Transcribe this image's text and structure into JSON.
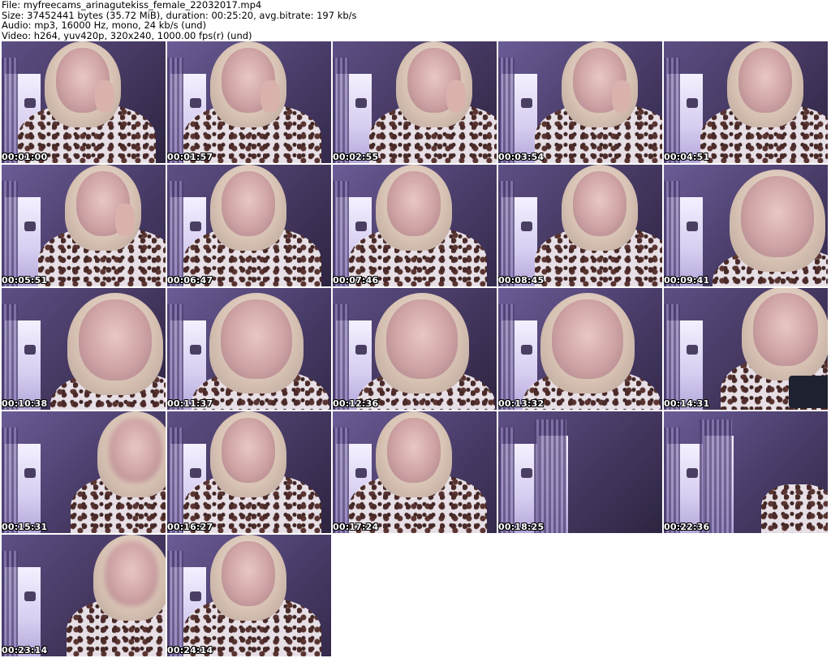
{
  "header": {
    "file_line": "File: myfreecams_arinagutekiss_female_22032017.mp4",
    "size_line": "Size: 37452441 bytes (35.72 MiB), duration: 00:25:20, avg.bitrate: 197 kb/s",
    "audio_line": "Audio: mp3, 16000 Hz, mono, 24 kb/s (und)",
    "video_line": "Video: h264, yuv420p, 320x240, 1000.00 fps(r) (und)"
  },
  "thumbnails": [
    {
      "timestamp": "00:01:00",
      "variant": "hand"
    },
    {
      "timestamp": "00:01:57",
      "variant": "hand"
    },
    {
      "timestamp": "00:02:55",
      "variant": "hand-right"
    },
    {
      "timestamp": "00:03:54",
      "variant": "hand-right"
    },
    {
      "timestamp": "00:04:51",
      "variant": "right"
    },
    {
      "timestamp": "00:05:51",
      "variant": "hand-right"
    },
    {
      "timestamp": "00:06:47",
      "variant": "center"
    },
    {
      "timestamp": "00:07:46",
      "variant": "center"
    },
    {
      "timestamp": "00:08:45",
      "variant": "right"
    },
    {
      "timestamp": "00:09:41",
      "variant": "close-right"
    },
    {
      "timestamp": "00:10:38",
      "variant": "close-right"
    },
    {
      "timestamp": "00:11:37",
      "variant": "close-center"
    },
    {
      "timestamp": "00:12:36",
      "variant": "close-center"
    },
    {
      "timestamp": "00:13:32",
      "variant": "close-center"
    },
    {
      "timestamp": "00:14:31",
      "variant": "phone"
    },
    {
      "timestamp": "00:15:31",
      "variant": "blur-right"
    },
    {
      "timestamp": "00:16:27",
      "variant": "center"
    },
    {
      "timestamp": "00:17:24",
      "variant": "center"
    },
    {
      "timestamp": "00:18:25",
      "variant": "empty"
    },
    {
      "timestamp": "00:22:36",
      "variant": "empty-robe"
    },
    {
      "timestamp": "00:23:14",
      "variant": "blur"
    },
    {
      "timestamp": "00:24:14",
      "variant": "center"
    }
  ]
}
